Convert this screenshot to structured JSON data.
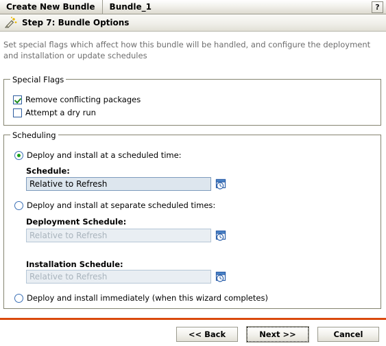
{
  "window": {
    "tab_primary": "Create New Bundle",
    "tab_secondary": "Bundle_1",
    "help_label": "?",
    "help_icon": "question-mark-icon"
  },
  "step_header": {
    "icon": "magic-wand-icon",
    "title": "Step 7: Bundle Options"
  },
  "description": "Set special flags which affect how this bundle will be handled, and configure the deployment and installation or update schedules",
  "special_flags": {
    "title": "Special Flags",
    "items": [
      {
        "label": "Remove conflicting packages",
        "checked": true
      },
      {
        "label": "Attempt a dry run",
        "checked": false
      }
    ]
  },
  "scheduling": {
    "title": "Scheduling",
    "option_scheduled_time": {
      "label": "Deploy and install at a scheduled time:",
      "selected": true,
      "field_label": "Schedule:",
      "field_value": "Relative to Refresh",
      "calendar_icon": "calendar-clock-icon"
    },
    "option_separate_times": {
      "label": "Deploy and install at separate scheduled times:",
      "selected": false,
      "deployment_label": "Deployment Schedule:",
      "deployment_value": "Relative to Refresh",
      "installation_label": "Installation Schedule:",
      "installation_value": "Relative to Refresh",
      "calendar_icon": "calendar-clock-icon"
    },
    "option_immediately": {
      "label": "Deploy and install immediately (when this wizard completes)",
      "selected": false
    }
  },
  "footer": {
    "back_label": "<< Back",
    "next_label": "Next >>",
    "cancel_label": "Cancel",
    "separator_color": "#d9490d"
  }
}
